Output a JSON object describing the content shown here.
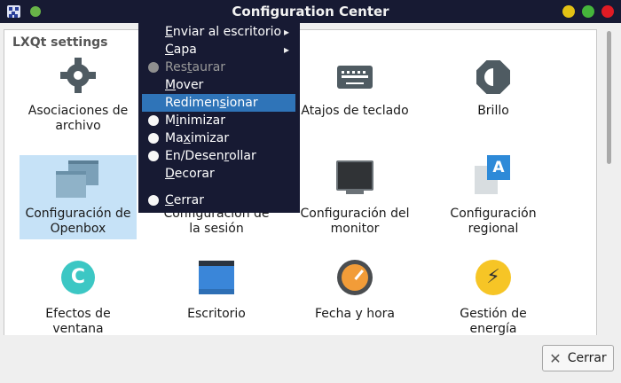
{
  "window": {
    "title": "Configuration Center"
  },
  "panel": {
    "group_title": "LXQt settings"
  },
  "items": [
    {
      "label": "Asociaciones de archivo",
      "icon": "gear-icon"
    },
    {
      "label": "Atajos de teclado",
      "icon": "keyboard-icon"
    },
    {
      "label": "Brillo",
      "icon": "brightness-icon"
    },
    {
      "label": "Configuración de Openbox",
      "icon": "windows-icon"
    },
    {
      "label": "Configuración de la sesión",
      "icon": "session-icon"
    },
    {
      "label": "Configuración del monitor",
      "icon": "monitor-icon"
    },
    {
      "label": "Configuración regional",
      "icon": "locale-icon"
    },
    {
      "label": "Efectos de ventana",
      "icon": "effects-icon"
    },
    {
      "label": "Escritorio",
      "icon": "desktop-icon"
    },
    {
      "label": "Fecha y hora",
      "icon": "clock-icon"
    },
    {
      "label": "Gestión de energía",
      "icon": "power-icon"
    }
  ],
  "context_menu": {
    "items": [
      {
        "pre": "",
        "u": "E",
        "post": "nviar al escritorio"
      },
      {
        "pre": "",
        "u": "C",
        "post": "apa"
      },
      {
        "pre": "Res",
        "u": "t",
        "post": "aurar"
      },
      {
        "pre": "",
        "u": "M",
        "post": "over"
      },
      {
        "pre": "Redimen",
        "u": "s",
        "post": "ionar"
      },
      {
        "pre": "M",
        "u": "i",
        "post": "nimizar"
      },
      {
        "pre": "Ma",
        "u": "x",
        "post": "imizar"
      },
      {
        "pre": "En/Desen",
        "u": "r",
        "post": "ollar"
      },
      {
        "pre": "",
        "u": "D",
        "post": "ecorar"
      },
      {
        "pre": "",
        "u": "C",
        "post": "errar"
      }
    ]
  },
  "footer": {
    "cancel_label": "Cerrar"
  }
}
